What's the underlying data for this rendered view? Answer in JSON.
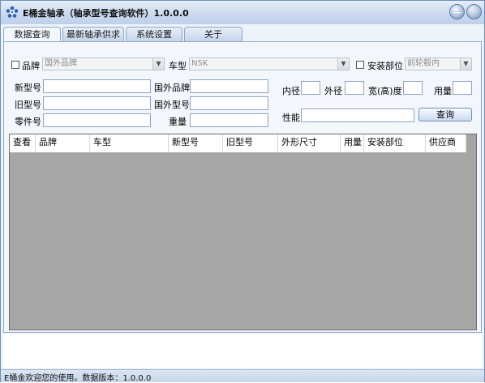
{
  "window": {
    "title": "E桶金轴承（轴承型号查询软件）1.0.0.0",
    "minimize_label": "—",
    "close_label": "✕",
    "logo_icon": "gear-flower-icon"
  },
  "tabs": [
    {
      "label": "数据查询"
    },
    {
      "label": "最新轴承供求"
    },
    {
      "label": "系统设置"
    },
    {
      "label": "关于"
    }
  ],
  "filters": {
    "brand_label": "品牌",
    "brand_value": "国外品牌",
    "car_label": "车型",
    "car_value": "NSK",
    "position_label": "安装部位",
    "position_value": "前轮毂内"
  },
  "form": {
    "new_model_label": "新型号",
    "old_model_label": "旧型号",
    "part_no_label": "零件号",
    "foreign_brand_label": "国外品牌",
    "foreign_model_label": "国外型号",
    "weight_label": "重量",
    "inner_label": "内径",
    "outer_label": "外径",
    "width_label": "宽(高)度",
    "qty_label": "用量",
    "performance_label": "性能",
    "query_button": "查询"
  },
  "grid": {
    "columns": [
      "查看",
      "品牌",
      "车型",
      "新型号",
      "旧型号",
      "外形尺寸",
      "用量",
      "安装部位",
      "供应商"
    ]
  },
  "status": {
    "text": "E桶金欢迎您的使用。数据版本：1.0.0.0"
  }
}
